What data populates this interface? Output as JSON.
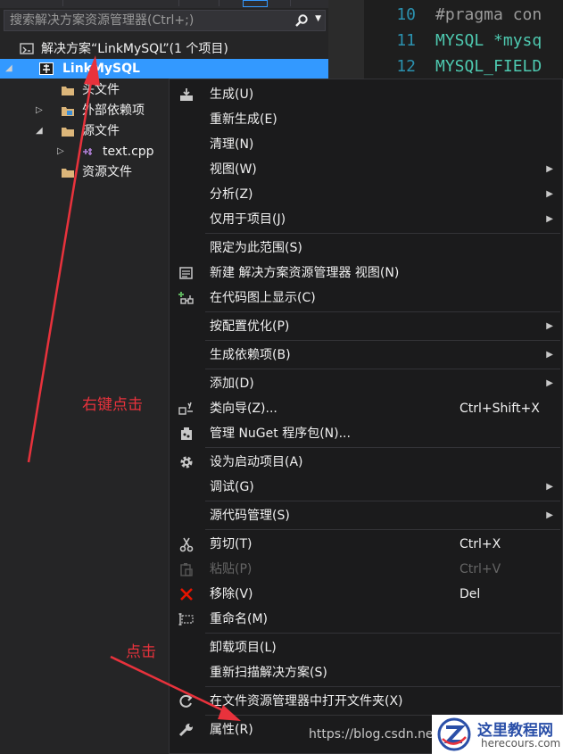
{
  "explorer": {
    "search_placeholder": "搜索解决方案资源管理器(Ctrl+;)",
    "items": [
      {
        "label": "解决方案“LinkMySQL”(1 个项目)",
        "expander": ""
      },
      {
        "label": "LinkMySQL",
        "expander": "◢"
      },
      {
        "label": "头文件",
        "expander": ""
      },
      {
        "label": "外部依赖项",
        "expander": "▷"
      },
      {
        "label": "源文件",
        "expander": "◢"
      },
      {
        "label": "text.cpp",
        "expander": "▷"
      },
      {
        "label": "资源文件",
        "expander": ""
      }
    ]
  },
  "editor": {
    "lines": [
      {
        "num": "10",
        "text": "#pragma con"
      },
      {
        "num": "11",
        "text": "MYSQL *mysq"
      },
      {
        "num": "12",
        "text": "MYSQL_FIELD"
      }
    ]
  },
  "context_menu": {
    "items": [
      {
        "label": "生成(U)",
        "shortcut": "",
        "icon": "build-icon"
      },
      {
        "label": "重新生成(E)",
        "shortcut": ""
      },
      {
        "label": "清理(N)",
        "shortcut": ""
      },
      {
        "label": "视图(W)",
        "shortcut": "",
        "submenu": true
      },
      {
        "label": "分析(Z)",
        "shortcut": "",
        "submenu": true
      },
      {
        "label": "仅用于项目(J)",
        "shortcut": "",
        "submenu": true
      },
      {
        "label": "限定为此范围(S)",
        "shortcut": ""
      },
      {
        "label": "新建 解决方案资源管理器 视图(N)",
        "shortcut": "",
        "icon": "new-view-icon"
      },
      {
        "label": "在代码图上显示(C)",
        "shortcut": "",
        "icon": "code-map-icon"
      },
      {
        "label": "按配置优化(P)",
        "shortcut": "",
        "submenu": true
      },
      {
        "label": "生成依赖项(B)",
        "shortcut": "",
        "submenu": true
      },
      {
        "label": "添加(D)",
        "shortcut": "",
        "submenu": true
      },
      {
        "label": "类向导(Z)...",
        "shortcut": "Ctrl+Shift+X",
        "icon": "class-wizard-icon"
      },
      {
        "label": "管理 NuGet 程序包(N)...",
        "shortcut": "",
        "icon": "nuget-icon"
      },
      {
        "label": "设为启动项目(A)",
        "shortcut": "",
        "icon": "gear-icon"
      },
      {
        "label": "调试(G)",
        "shortcut": "",
        "submenu": true
      },
      {
        "label": "源代码管理(S)",
        "shortcut": "",
        "submenu": true
      },
      {
        "label": "剪切(T)",
        "shortcut": "Ctrl+X",
        "icon": "scissors-icon"
      },
      {
        "label": "粘贴(P)",
        "shortcut": "Ctrl+V",
        "icon": "paste-icon",
        "disabled": true
      },
      {
        "label": "移除(V)",
        "shortcut": "Del",
        "icon": "remove-x-icon"
      },
      {
        "label": "重命名(M)",
        "shortcut": "",
        "icon": "rename-icon"
      },
      {
        "label": "卸载项目(L)",
        "shortcut": ""
      },
      {
        "label": "重新扫描解决方案(S)",
        "shortcut": ""
      },
      {
        "label": "在文件资源管理器中打开文件夹(X)",
        "shortcut": "",
        "icon": "open-folder-icon"
      },
      {
        "label": "属性(R)",
        "shortcut": "",
        "icon": "wrench-icon"
      }
    ]
  },
  "annotations": {
    "right_click": "右键点击",
    "click": "点击"
  },
  "watermark": {
    "csdn": "https://blog.csdn.ne",
    "site_name": "这里教程网",
    "site_url": "herecours.com"
  },
  "colors": {
    "selection": "#3399ff",
    "annotation_red": "#e8323c",
    "menu_bg": "#1b1b1c",
    "explorer_bg": "#252526",
    "editor_bg": "#1e1e1e"
  }
}
